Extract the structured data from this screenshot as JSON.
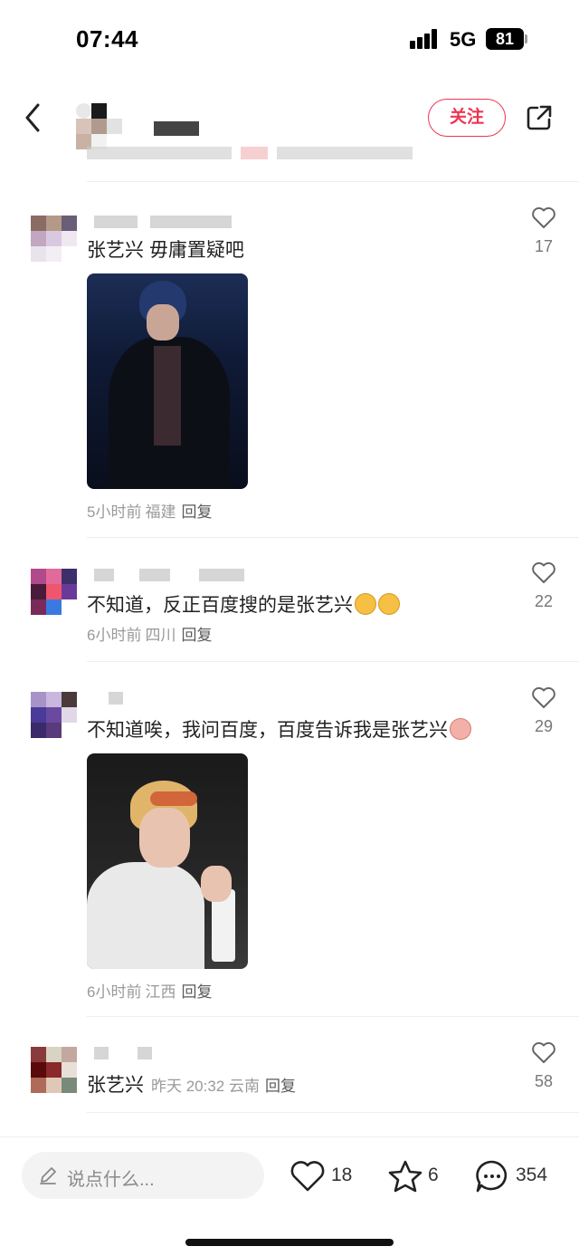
{
  "status_bar": {
    "time": "07:44",
    "network": "5G",
    "battery": "81"
  },
  "header": {
    "follow_label": "关注"
  },
  "comments": [
    {
      "text": "张艺兴  毋庸置疑吧",
      "likes": "17",
      "time": "5小时前",
      "location": "福建",
      "reply": "回复",
      "has_image": true
    },
    {
      "text": "不知道，反正百度搜的是张艺兴",
      "likes": "22",
      "time": "6小时前",
      "location": "四川",
      "reply": "回复"
    },
    {
      "text": "不知道唉，我问百度，百度告诉我是张艺兴",
      "likes": "29",
      "time": "6小时前",
      "location": "江西",
      "reply": "回复",
      "has_image": true
    },
    {
      "text": "张艺兴",
      "likes": "58",
      "time": "昨天 20:32",
      "location": "云南",
      "reply": "回复"
    }
  ],
  "bottom_bar": {
    "input_placeholder": "说点什么...",
    "likes": "18",
    "favorites": "6",
    "comments": "354"
  },
  "colors": {
    "accent": "#ee3552",
    "meta_text": "#9a9a9a"
  },
  "icons": [
    "back-icon",
    "share-icon",
    "heart-icon",
    "star-icon",
    "comment-bubble-icon",
    "pencil-icon"
  ]
}
